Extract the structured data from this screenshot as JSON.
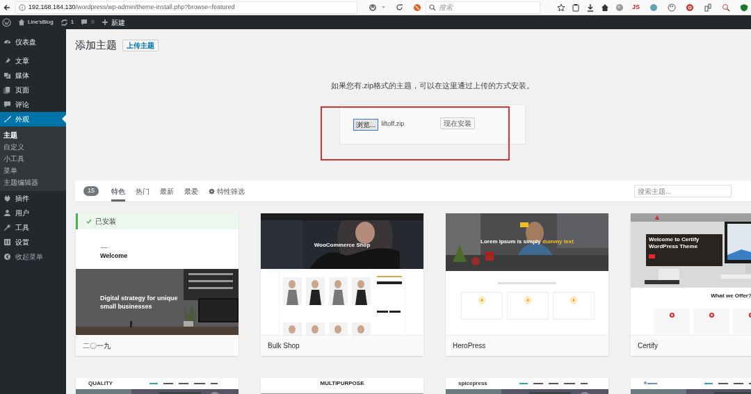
{
  "browser": {
    "url_host": "192.168.184.130",
    "url_path": "/wordpress/wp-admin/theme-install.php?browse=featured",
    "search_placeholder": "搜索",
    "js_label": "JS"
  },
  "admin_bar": {
    "site": "Line'sBlog",
    "updates": "1",
    "comments": "0",
    "new": "新建"
  },
  "sidebar": {
    "items": [
      {
        "label": "仪表盘",
        "selected": false
      },
      {
        "label": "文章",
        "selected": false
      },
      {
        "label": "媒体",
        "selected": false
      },
      {
        "label": "页面",
        "selected": false
      },
      {
        "label": "评论",
        "selected": false
      },
      {
        "label": "外观",
        "selected": true,
        "children": [
          {
            "label": "主题",
            "selected": true
          },
          {
            "label": "自定义",
            "selected": false
          },
          {
            "label": "小工具",
            "selected": false
          },
          {
            "label": "菜单",
            "selected": false
          },
          {
            "label": "主题编辑器",
            "selected": false
          }
        ]
      },
      {
        "label": "插件",
        "selected": false
      },
      {
        "label": "用户",
        "selected": false
      },
      {
        "label": "工具",
        "selected": false
      },
      {
        "label": "设置",
        "selected": false
      }
    ],
    "collapse": "收起菜单"
  },
  "page": {
    "title": "添加主题",
    "upload_button": "上传主题",
    "upload_hint": "如果您有.zip格式的主题，可以在这里通过上传的方式安装。",
    "upload_form": {
      "browse_button": "浏览...",
      "file_name": "liftoff.zip",
      "install_button": "现在安装",
      "highlighted": true
    }
  },
  "filter_bar": {
    "count": "15",
    "tabs": [
      {
        "label": "特色",
        "selected": true
      },
      {
        "label": "热门",
        "selected": false
      },
      {
        "label": "最新",
        "selected": false
      },
      {
        "label": "最爱",
        "selected": false
      }
    ],
    "feature_filter": "特性筛选",
    "search_placeholder": "搜索主题..."
  },
  "installed_label": "已安装",
  "themes": [
    {
      "kind": "twentynineteen",
      "name": "二〇一九",
      "installed": true,
      "welcome": "Welcome",
      "headline": "Digital strategy for unique small businesses"
    },
    {
      "kind": "shop",
      "name": "Bulk Shop",
      "installed": false,
      "headline": "WooCommerce Shop"
    },
    {
      "kind": "hero",
      "name": "HeroPress",
      "installed": false,
      "headline": "Lorem Ipsum is simply",
      "highlight": "dummy text"
    },
    {
      "kind": "certify",
      "name": "Certify",
      "installed": false,
      "headline": "Welcome to Certify WordPress Theme",
      "section": "What we Offer?"
    },
    {
      "kind": "header",
      "installed": false,
      "brand": "QUALITY"
    },
    {
      "kind": "centered",
      "installed": false,
      "brand": "MULTIPURPOSE"
    },
    {
      "kind": "header",
      "installed": false,
      "brand": "spicepress"
    },
    {
      "kind": "header",
      "installed": false
    }
  ]
}
